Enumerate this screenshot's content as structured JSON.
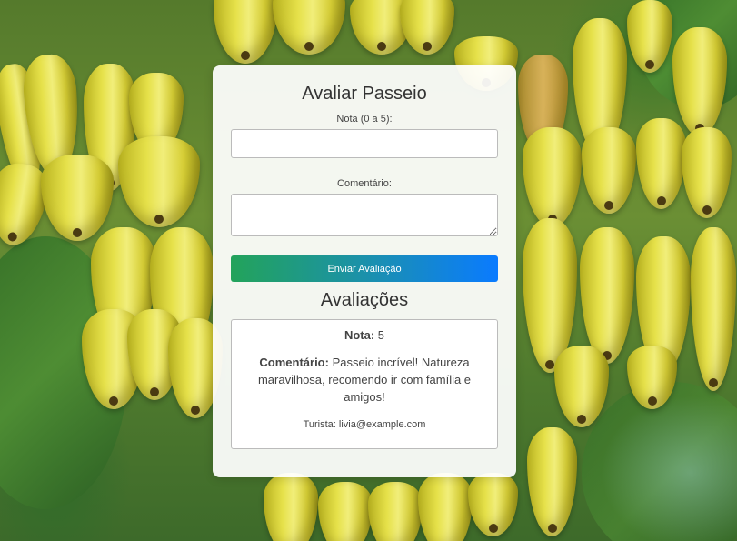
{
  "form": {
    "title": "Avaliar Passeio",
    "rating_label": "Nota (0 a 5):",
    "rating_value": "",
    "comment_label": "Comentário:",
    "comment_value": "",
    "submit_label": "Enviar Avaliação"
  },
  "reviews": {
    "title": "Avaliações",
    "items": [
      {
        "rating_prefix": "Nota:",
        "rating": "5",
        "comment_prefix": "Comentário:",
        "comment": "Passeio incrível! Natureza maravilhosa, recomendo ir com família e amigos!",
        "tourist_prefix": "Turista:",
        "tourist": "livia@example.com"
      }
    ]
  },
  "colors": {
    "button_gradient_start": "#23a35a",
    "button_gradient_end": "#0a7bff",
    "card_background": "#ffffff"
  }
}
